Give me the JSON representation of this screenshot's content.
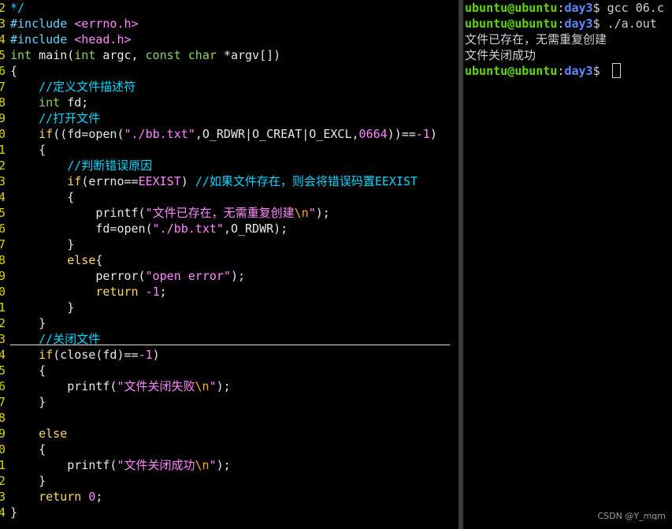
{
  "editor": {
    "lines": [
      {
        "num": "2",
        "tokens": [
          {
            "t": "*/",
            "c": "cm"
          }
        ]
      },
      {
        "num": "3",
        "tokens": [
          {
            "t": "#include ",
            "c": "pre"
          },
          {
            "t": "<errno.h>",
            "c": "str"
          }
        ]
      },
      {
        "num": "4",
        "tokens": [
          {
            "t": "#include ",
            "c": "pre"
          },
          {
            "t": "<head.h>",
            "c": "str"
          }
        ]
      },
      {
        "num": "5",
        "tokens": [
          {
            "t": "int",
            "c": "ty"
          },
          {
            "t": " main(",
            "c": "txt"
          },
          {
            "t": "int",
            "c": "ty"
          },
          {
            "t": " argc, ",
            "c": "txt"
          },
          {
            "t": "const",
            "c": "ty"
          },
          {
            "t": " ",
            "c": "txt"
          },
          {
            "t": "char",
            "c": "ty"
          },
          {
            "t": " *argv[])",
            "c": "txt"
          }
        ]
      },
      {
        "num": "6",
        "tokens": [
          {
            "t": "{",
            "c": "txt"
          }
        ]
      },
      {
        "num": "7",
        "tokens": [
          {
            "t": "    //定义文件描述符",
            "c": "cm"
          }
        ]
      },
      {
        "num": "8",
        "tokens": [
          {
            "t": "    ",
            "c": "txt"
          },
          {
            "t": "int",
            "c": "ty"
          },
          {
            "t": " fd;",
            "c": "txt"
          }
        ]
      },
      {
        "num": "9",
        "tokens": [
          {
            "t": "    //打开文件",
            "c": "cm"
          }
        ]
      },
      {
        "num": "0",
        "tokens": [
          {
            "t": "    ",
            "c": "txt"
          },
          {
            "t": "if",
            "c": "kw"
          },
          {
            "t": "((fd=open(",
            "c": "txt"
          },
          {
            "t": "\"./bb.txt\"",
            "c": "str"
          },
          {
            "t": ",O_RDWR|O_CREAT|O_EXCL,",
            "c": "txt"
          },
          {
            "t": "0664",
            "c": "num"
          },
          {
            "t": "))==",
            "c": "txt"
          },
          {
            "t": "-1",
            "c": "num"
          },
          {
            "t": ")",
            "c": "txt"
          }
        ]
      },
      {
        "num": "1",
        "tokens": [
          {
            "t": "    {",
            "c": "txt"
          }
        ]
      },
      {
        "num": "2",
        "tokens": [
          {
            "t": "        //判断错误原因",
            "c": "cm"
          }
        ]
      },
      {
        "num": "3",
        "tokens": [
          {
            "t": "        ",
            "c": "txt"
          },
          {
            "t": "if",
            "c": "kw"
          },
          {
            "t": "(errno==",
            "c": "txt"
          },
          {
            "t": "EEXIST",
            "c": "str"
          },
          {
            "t": ") ",
            "c": "txt"
          },
          {
            "t": "//如果文件存在，则会将错误码置EEXIST",
            "c": "cm"
          }
        ]
      },
      {
        "num": "4",
        "tokens": [
          {
            "t": "        {",
            "c": "txt"
          }
        ]
      },
      {
        "num": "5",
        "tokens": [
          {
            "t": "            printf(",
            "c": "txt"
          },
          {
            "t": "\"文件已存在，无需重复创建",
            "c": "str"
          },
          {
            "t": "\\n",
            "c": "esc"
          },
          {
            "t": "\"",
            "c": "str"
          },
          {
            "t": ");",
            "c": "txt"
          }
        ]
      },
      {
        "num": "6",
        "tokens": [
          {
            "t": "            fd=open(",
            "c": "txt"
          },
          {
            "t": "\"./bb.txt\"",
            "c": "str"
          },
          {
            "t": ",O_RDWR);",
            "c": "txt"
          }
        ]
      },
      {
        "num": "7",
        "tokens": [
          {
            "t": "        }",
            "c": "txt"
          }
        ]
      },
      {
        "num": "8",
        "tokens": [
          {
            "t": "        ",
            "c": "txt"
          },
          {
            "t": "else",
            "c": "kw"
          },
          {
            "t": "{",
            "c": "txt"
          }
        ]
      },
      {
        "num": "9",
        "tokens": [
          {
            "t": "            perror(",
            "c": "txt"
          },
          {
            "t": "\"open error\"",
            "c": "str"
          },
          {
            "t": ");",
            "c": "txt"
          }
        ]
      },
      {
        "num": "0",
        "tokens": [
          {
            "t": "            ",
            "c": "txt"
          },
          {
            "t": "return",
            "c": "kw"
          },
          {
            "t": " ",
            "c": "txt"
          },
          {
            "t": "-1",
            "c": "num"
          },
          {
            "t": ";",
            "c": "txt"
          }
        ]
      },
      {
        "num": "1",
        "tokens": [
          {
            "t": "        }",
            "c": "txt"
          }
        ]
      },
      {
        "num": "2",
        "tokens": [
          {
            "t": "    }",
            "c": "txt"
          }
        ]
      },
      {
        "num": "3",
        "tokens": [
          {
            "t": "    //关闭文件",
            "c": "cm"
          }
        ]
      },
      {
        "num": "4",
        "tokens": [
          {
            "t": "    ",
            "c": "txt"
          },
          {
            "t": "if",
            "c": "kw"
          },
          {
            "t": "(close(fd)==",
            "c": "txt"
          },
          {
            "t": "-1",
            "c": "num"
          },
          {
            "t": ")",
            "c": "txt"
          }
        ]
      },
      {
        "num": "5",
        "tokens": [
          {
            "t": "    {",
            "c": "txt"
          }
        ]
      },
      {
        "num": "6",
        "tokens": [
          {
            "t": "        printf(",
            "c": "txt"
          },
          {
            "t": "\"文件关闭失败",
            "c": "str"
          },
          {
            "t": "\\n",
            "c": "esc"
          },
          {
            "t": "\"",
            "c": "str"
          },
          {
            "t": ");",
            "c": "txt"
          }
        ]
      },
      {
        "num": "7",
        "tokens": [
          {
            "t": "    }",
            "c": "txt"
          }
        ]
      },
      {
        "num": "8",
        "tokens": []
      },
      {
        "num": "9",
        "tokens": [
          {
            "t": "    ",
            "c": "txt"
          },
          {
            "t": "else",
            "c": "kw"
          }
        ]
      },
      {
        "num": "0",
        "tokens": [
          {
            "t": "    {",
            "c": "txt"
          }
        ]
      },
      {
        "num": "1",
        "tokens": [
          {
            "t": "        printf(",
            "c": "txt"
          },
          {
            "t": "\"文件关闭成功",
            "c": "str"
          },
          {
            "t": "\\n",
            "c": "esc"
          },
          {
            "t": "\"",
            "c": "str"
          },
          {
            "t": ");",
            "c": "txt"
          }
        ]
      },
      {
        "num": "2",
        "tokens": [
          {
            "t": "    }",
            "c": "txt"
          }
        ]
      },
      {
        "num": "3",
        "tokens": [
          {
            "t": "    ",
            "c": "txt"
          },
          {
            "t": "return",
            "c": "kw"
          },
          {
            "t": " ",
            "c": "txt"
          },
          {
            "t": "0",
            "c": "num"
          },
          {
            "t": ";",
            "c": "txt"
          }
        ]
      },
      {
        "num": "4",
        "tokens": [
          {
            "t": "}",
            "c": "txt"
          }
        ]
      }
    ]
  },
  "terminal": {
    "prompt_user": "ubuntu@ubuntu",
    "prompt_sep": ":",
    "prompt_path": "day3",
    "prompt_end": "$ ",
    "lines": [
      {
        "kind": "cmd",
        "text": "gcc 06.c"
      },
      {
        "kind": "cmd",
        "text": "./a.out"
      },
      {
        "kind": "out",
        "text": "文件已存在，无需重复创建"
      },
      {
        "kind": "out",
        "text": "文件关闭成功"
      },
      {
        "kind": "cursor",
        "text": ""
      }
    ]
  },
  "watermark": "CSDN @Y_mqm",
  "colors": {
    "background": "#000000",
    "line_number": "#d7d700",
    "comment": "#00d7ff",
    "string": "#ff87ff",
    "keyword": "#ffd75f",
    "type": "#87d75f",
    "prompt_user": "#5fd700",
    "prompt_path": "#5f87ff"
  }
}
